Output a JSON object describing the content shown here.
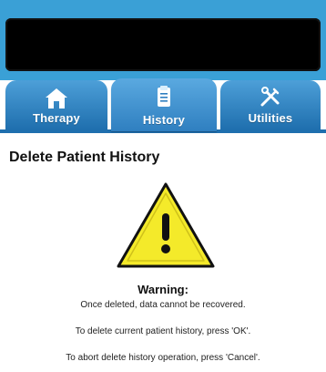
{
  "tabs": [
    {
      "label": "Therapy",
      "icon": "home-icon",
      "active": false
    },
    {
      "label": "History",
      "icon": "clipboard-icon",
      "active": true
    },
    {
      "label": "Utilities",
      "icon": "tools-icon",
      "active": false
    }
  ],
  "page": {
    "title": "Delete Patient History"
  },
  "warning": {
    "icon": "warning-triangle-icon",
    "title": "Warning:",
    "line1": "Once deleted, data cannot be recovered.",
    "line2": "To delete current patient history, press 'OK'.",
    "line3": "To abort delete history operation, press 'Cancel'."
  },
  "colors": {
    "accent": "#3aa0d6",
    "tab": "#2f7fc0",
    "warning_fill": "#f4ea2a",
    "warning_stroke": "#111111"
  }
}
